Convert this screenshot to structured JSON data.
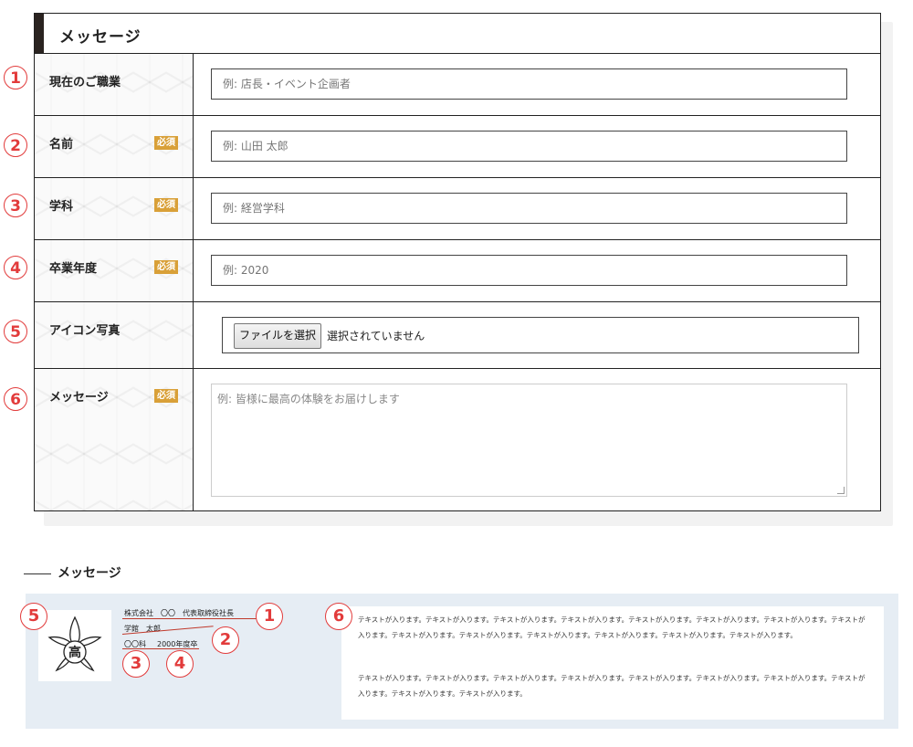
{
  "form": {
    "title": "メッセージ",
    "required_label": "必須",
    "rows": [
      {
        "num": "1",
        "label": "現在のご職業",
        "placeholder": "例: 店長・イベント企画者"
      },
      {
        "num": "2",
        "label": "名前",
        "placeholder": "例: 山田 太郎"
      },
      {
        "num": "3",
        "label": "学科",
        "placeholder": "例: 経営学科"
      },
      {
        "num": "4",
        "label": "卒業年度",
        "placeholder": "例: 2020"
      },
      {
        "num": "5",
        "label": "アイコン写真",
        "file_button": "ファイルを選択",
        "file_status": "選択されていません"
      },
      {
        "num": "6",
        "label": "メッセージ",
        "placeholder": "例: 皆様に最高の体験をお届けします"
      }
    ]
  },
  "preview": {
    "heading": "メッセージ",
    "emblem_char": "高",
    "occupation": "株式会社　〇〇　代表取締役社長",
    "name": "学館　太郎",
    "department": "〇〇科",
    "year": "2000年度卒",
    "message_para1": "テキストが入ります。テキストが入ります。テキストが入ります。テキストが入ります。テキストが入ります。テキストが入ります。テキストが入ります。テキストが入ります。テキストが入ります。テキストが入ります。テキストが入ります。テキストが入ります。テキストが入ります。テキストが入ります。",
    "message_para2": "テキストが入ります。テキストが入ります。テキストが入ります。テキストが入ります。テキストが入ります。テキストが入ります。テキストが入ります。テキストが入ります。テキストが入ります。テキストが入ります。",
    "markers": [
      "1",
      "2",
      "3",
      "4",
      "5",
      "6"
    ]
  },
  "colors": {
    "accent_red": "#e23b3b",
    "required_badge": "#d9a038",
    "card_background": "#e6edf4"
  }
}
